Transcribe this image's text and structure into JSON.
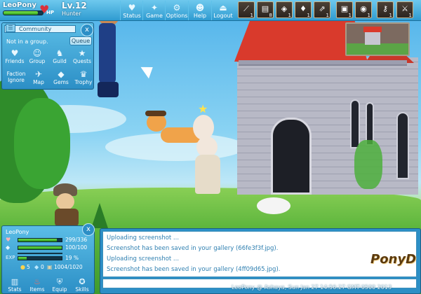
{
  "player": {
    "name": "LeoPony",
    "level": "Lv.12",
    "class": "Hunter",
    "hp_label": "HP",
    "hp_fraction": 0.89
  },
  "top_menu": [
    {
      "label": "Status",
      "icon": "heart-icon"
    },
    {
      "label": "Game",
      "icon": "gamepad-icon"
    },
    {
      "label": "Options",
      "icon": "gear-icon"
    },
    {
      "label": "Help",
      "icon": "person-icon"
    },
    {
      "label": "Logout",
      "icon": "door-icon"
    }
  ],
  "hotbar": [
    {
      "icon": "bow-icon",
      "count": "1"
    },
    {
      "icon": "scroll-icon",
      "count": "8"
    },
    {
      "icon": "bag-icon",
      "count": "1"
    },
    {
      "icon": "potion-icon",
      "count": "1"
    },
    {
      "icon": "arrows-icon",
      "count": "1"
    },
    {
      "icon": "map-item-icon",
      "count": "1"
    },
    {
      "icon": "pouch-icon",
      "count": "1"
    },
    {
      "icon": "key-icon",
      "count": "1"
    },
    {
      "icon": "sword-icon",
      "count": "1"
    }
  ],
  "community": {
    "title": "Community",
    "status": "Not in a group.",
    "queue_label": "Queue",
    "close": "x",
    "buttons": [
      {
        "label": "Friends",
        "icon": "friends-icon"
      },
      {
        "label": "Group",
        "icon": "group-icon"
      },
      {
        "label": "Guild",
        "icon": "guild-icon"
      },
      {
        "label": "Quests",
        "icon": "star-icon"
      },
      {
        "label": "Faction Ignore",
        "icon": "faction-icon"
      },
      {
        "label": "Map",
        "icon": "map-icon"
      },
      {
        "label": "Gems",
        "icon": "gem-icon"
      },
      {
        "label": "Trophy",
        "icon": "trophy-icon"
      }
    ]
  },
  "stats": {
    "name": "LeoPony",
    "close": "x",
    "hp": {
      "value": "299/336",
      "fraction": 0.89
    },
    "mp": {
      "value": "100/100",
      "fraction": 1.0
    },
    "exp": {
      "label": "EXP",
      "value": "19 %",
      "fraction": 0.19
    },
    "gold": "5",
    "tokens": "0",
    "bag": "1004/1020",
    "buttons": [
      {
        "label": "Stats",
        "icon": "bars-icon"
      },
      {
        "label": "Items",
        "icon": "items-icon"
      },
      {
        "label": "Equip",
        "icon": "shield-icon"
      },
      {
        "label": "Skills",
        "icon": "skills-icon"
      }
    ]
  },
  "chat": {
    "lines": [
      "Uploading screenshot ...",
      "Screenshot has been saved in your gallery (66fe3f3f.jpg).",
      "Uploading screenshot ...",
      "Screenshot has been saved in your gallery (4ff09d65.jpg)."
    ],
    "input_value": ""
  },
  "footer": {
    "screenshot_info": "LeoPony @ Ashaya, Sun Jan 27 14:56:27 GMT-0500 2013",
    "brand": "PonyD"
  },
  "colors": {
    "ui_blue": "#2c8fc6",
    "roof_red": "#d93a2c",
    "hp_green": "#2f9c1d"
  }
}
